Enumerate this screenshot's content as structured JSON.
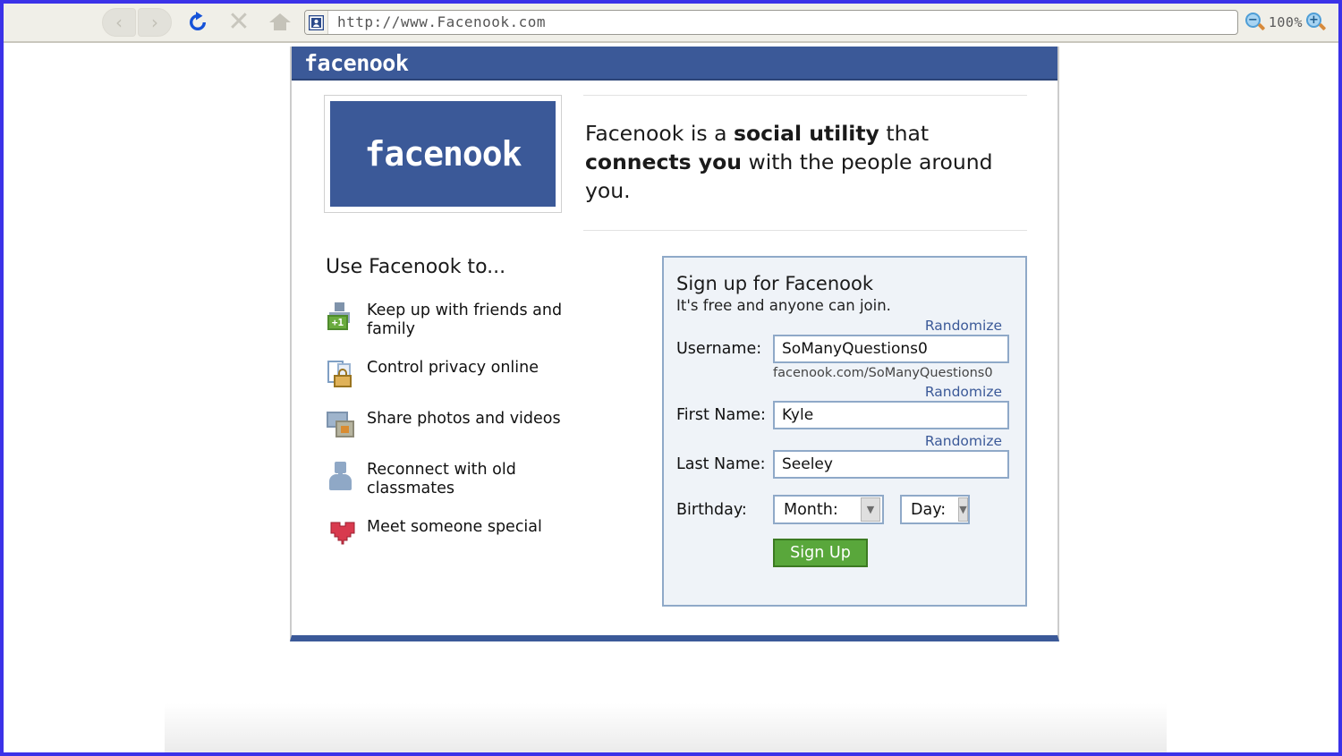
{
  "browser": {
    "back_label": "‹",
    "forward_label": "›",
    "stop_label": "✕",
    "url": "http://www.Facenook.com",
    "zoom_level": "100%",
    "zoom_out_label": "−",
    "zoom_in_label": "+"
  },
  "site": {
    "header_logo": "facenook",
    "logo_box_text": "facenook",
    "tagline": {
      "part1": "Facenook is a ",
      "bold1": "social utility",
      "part2": " that ",
      "bold2": "connects you",
      "part3": " with the people around you."
    },
    "features": {
      "title": "Use Facenook to...",
      "items": [
        {
          "icon": "friends-icon",
          "label": "Keep up with friends and family",
          "badge": "+1"
        },
        {
          "icon": "privacy-lock-icon",
          "label": "Control privacy online"
        },
        {
          "icon": "photos-icon",
          "label": "Share photos and videos"
        },
        {
          "icon": "person-icon",
          "label": "Reconnect with old classmates"
        },
        {
          "icon": "heart-icon",
          "label": "Meet someone special"
        }
      ]
    },
    "signup": {
      "title": "Sign up for Facenook",
      "subtitle": "It's free and anyone can join.",
      "randomize_label": "Randomize",
      "username_label": "Username:",
      "username_value": "SoManyQuestions0",
      "username_hint": "facenook.com/SoManyQuestions0",
      "first_name_label": "First Name:",
      "first_name_value": "Kyle",
      "last_name_label": "Last Name:",
      "last_name_value": "Seeley",
      "birthday_label": "Birthday:",
      "month_placeholder": "Month:",
      "day_placeholder": "Day:",
      "dropdown_arrow": "▼",
      "signup_button_label": "Sign Up"
    }
  },
  "colors": {
    "brand_blue": "#3b5998",
    "panel_border": "#8fa9c8",
    "panel_bg": "#eff3f8",
    "link_blue": "#3b5998",
    "signup_green": "#59a73b",
    "frame_purple": "#3b32e8"
  }
}
